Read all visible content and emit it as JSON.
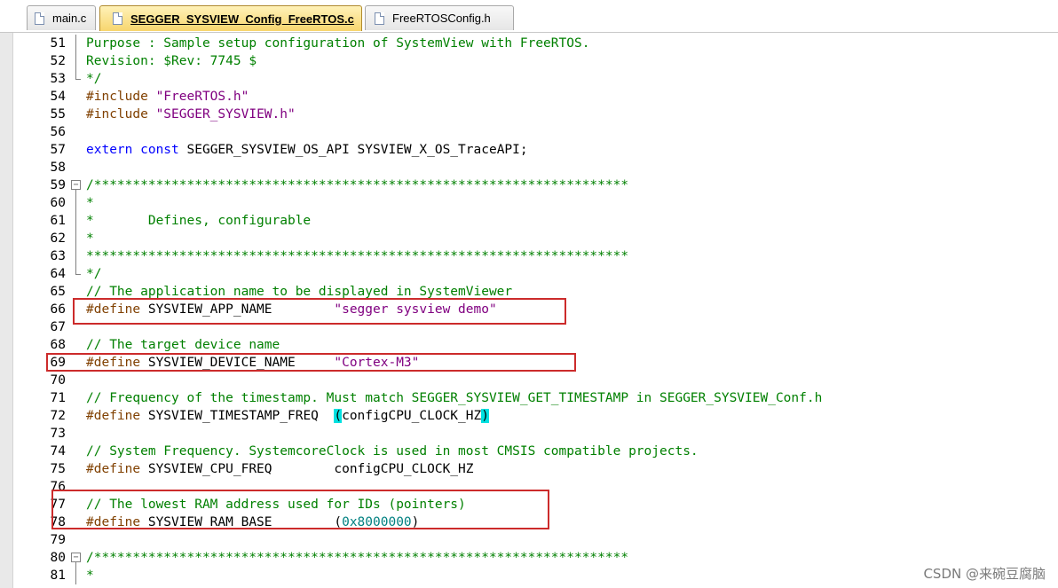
{
  "tabs": [
    {
      "label": "main.c",
      "active": false
    },
    {
      "label": "SEGGER_SYSVIEW_Config_FreeRTOS.c",
      "active": true
    },
    {
      "label": "FreeRTOSConfig.h",
      "active": false
    }
  ],
  "lines": [
    {
      "num": "51",
      "fold": "vline",
      "tokens": [
        {
          "t": "Purpose : Sample setup configuration of SystemView with FreeRTOS.",
          "c": "c"
        }
      ]
    },
    {
      "num": "52",
      "fold": "vline",
      "tokens": [
        {
          "t": "Revision: $Rev: 7745 $",
          "c": "c"
        }
      ]
    },
    {
      "num": "53",
      "fold": "end",
      "tokens": [
        {
          "t": "*/",
          "c": "c"
        }
      ]
    },
    {
      "num": "54",
      "fold": "",
      "tokens": [
        {
          "t": "#include ",
          "c": "pp"
        },
        {
          "t": "\"FreeRTOS.h\"",
          "c": "s"
        }
      ]
    },
    {
      "num": "55",
      "fold": "",
      "tokens": [
        {
          "t": "#include ",
          "c": "pp"
        },
        {
          "t": "\"SEGGER_SYSVIEW.h\"",
          "c": "s"
        }
      ]
    },
    {
      "num": "56",
      "fold": "",
      "tokens": []
    },
    {
      "num": "57",
      "fold": "",
      "tokens": [
        {
          "t": "extern const ",
          "c": "k"
        },
        {
          "t": "SEGGER_SYSVIEW_OS_API SYSVIEW_X_OS_TraceAPI;",
          "c": "n"
        }
      ]
    },
    {
      "num": "58",
      "fold": "",
      "tokens": []
    },
    {
      "num": "59",
      "fold": "box",
      "tokens": [
        {
          "t": "/*********************************************************************",
          "c": "c"
        }
      ]
    },
    {
      "num": "60",
      "fold": "vline",
      "tokens": [
        {
          "t": "*",
          "c": "c"
        }
      ]
    },
    {
      "num": "61",
      "fold": "vline",
      "tokens": [
        {
          "t": "*       Defines, configurable",
          "c": "c"
        }
      ]
    },
    {
      "num": "62",
      "fold": "vline",
      "tokens": [
        {
          "t": "*",
          "c": "c"
        }
      ]
    },
    {
      "num": "63",
      "fold": "vline",
      "tokens": [
        {
          "t": "**********************************************************************",
          "c": "c"
        }
      ]
    },
    {
      "num": "64",
      "fold": "end",
      "tokens": [
        {
          "t": "*/",
          "c": "c"
        }
      ]
    },
    {
      "num": "65",
      "fold": "",
      "tokens": [
        {
          "t": "// The application name to be displayed in SystemViewer",
          "c": "c"
        }
      ]
    },
    {
      "num": "66",
      "fold": "",
      "tokens": [
        {
          "t": "#define ",
          "c": "pp"
        },
        {
          "t": "SYSVIEW_APP_NAME        ",
          "c": "n"
        },
        {
          "t": "\"segger sysview demo\"",
          "c": "s"
        }
      ]
    },
    {
      "num": "67",
      "fold": "",
      "tokens": []
    },
    {
      "num": "68",
      "fold": "",
      "tokens": [
        {
          "t": "// The target device name",
          "c": "c"
        }
      ]
    },
    {
      "num": "69",
      "fold": "",
      "tokens": [
        {
          "t": "#define ",
          "c": "pp"
        },
        {
          "t": "SYSVIEW_DEVICE_NAME     ",
          "c": "n"
        },
        {
          "t": "\"Cortex-M3\"",
          "c": "s"
        }
      ]
    },
    {
      "num": "70",
      "fold": "",
      "tokens": []
    },
    {
      "num": "71",
      "fold": "",
      "tokens": [
        {
          "t": "// Frequency of the timestamp. Must match SEGGER_SYSVIEW_GET_TIMESTAMP in SEGGER_SYSVIEW_Conf.h",
          "c": "c"
        }
      ]
    },
    {
      "num": "72",
      "fold": "",
      "tokens": [
        {
          "t": "#define ",
          "c": "pp"
        },
        {
          "t": "SYSVIEW_TIMESTAMP_FREQ  ",
          "c": "n"
        },
        {
          "t": "(",
          "c": "n hl"
        },
        {
          "t": "configCPU_CLOCK_HZ",
          "c": "n"
        },
        {
          "t": ")",
          "c": "n hl"
        }
      ]
    },
    {
      "num": "73",
      "fold": "",
      "tokens": []
    },
    {
      "num": "74",
      "fold": "",
      "tokens": [
        {
          "t": "// System Frequency. SystemcoreClock is used in most CMSIS compatible projects.",
          "c": "c"
        }
      ]
    },
    {
      "num": "75",
      "fold": "",
      "tokens": [
        {
          "t": "#define ",
          "c": "pp"
        },
        {
          "t": "SYSVIEW_CPU_FREQ        configCPU_CLOCK_HZ",
          "c": "n"
        }
      ]
    },
    {
      "num": "76",
      "fold": "",
      "tokens": []
    },
    {
      "num": "77",
      "fold": "",
      "tokens": [
        {
          "t": "// The lowest RAM address used for IDs (pointers)",
          "c": "c"
        }
      ]
    },
    {
      "num": "78",
      "fold": "",
      "tokens": [
        {
          "t": "#define ",
          "c": "pp"
        },
        {
          "t": "SYSVIEW_RAM_BASE        ",
          "c": "n"
        },
        {
          "t": "(",
          "c": "n"
        },
        {
          "t": "0x8000000",
          "c": "num"
        },
        {
          "t": ")",
          "c": "n"
        }
      ]
    },
    {
      "num": "79",
      "fold": "",
      "tokens": []
    },
    {
      "num": "80",
      "fold": "box",
      "tokens": [
        {
          "t": "/*********************************************************************",
          "c": "c"
        }
      ]
    },
    {
      "num": "81",
      "fold": "vline",
      "tokens": [
        {
          "t": "*",
          "c": "c"
        }
      ]
    }
  ],
  "highlight_boxes": [
    {
      "name": "highlight-app-name"
    },
    {
      "name": "highlight-device-name"
    },
    {
      "name": "highlight-ram-base"
    }
  ],
  "watermark": "CSDN @来碗豆腐脑",
  "colors": {
    "keyword": "#0000ff",
    "comment": "#008000",
    "string": "#800080",
    "preprocessor": "#804000",
    "number": "#008080",
    "bracket_highlight": "#00e0e0",
    "annotation_box": "#cc2b2b",
    "active_tab": "#f7d66e"
  }
}
